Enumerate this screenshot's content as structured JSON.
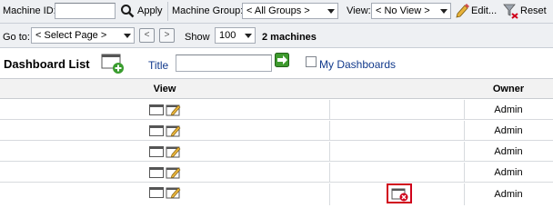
{
  "toolbar": {
    "machine_id_label": "Machine ID:",
    "machine_id_value": "",
    "apply_label": "Apply",
    "machine_group_label": "Machine Group:",
    "machine_group_value": "< All Groups >",
    "view_label": "View:",
    "view_value": "< No View >",
    "edit_label": "Edit...",
    "reset_label": "Reset"
  },
  "paging": {
    "goto_label": "Go to:",
    "goto_value": "< Select Page >",
    "prev_label": "<",
    "next_label": ">",
    "show_label": "Show",
    "show_value": "100",
    "machine_count": "2 machines"
  },
  "dashboard": {
    "title": "Dashboard List",
    "title_filter_label": "Title",
    "title_filter_value": "",
    "my_dashboards_label": "My Dashboards",
    "my_dashboards_checked": false
  },
  "table": {
    "columns": [
      "View",
      "Owner"
    ],
    "rows": [
      {
        "owner": "Admin"
      },
      {
        "owner": "Admin"
      },
      {
        "owner": "Admin"
      },
      {
        "owner": "Admin"
      },
      {
        "owner": "Admin",
        "has_delete": true
      }
    ]
  },
  "colors": {
    "toolbar_bg": "#eef0f3",
    "link_blue": "#123a8c",
    "highlight_red": "#d0021b"
  },
  "icons": [
    "search-icon",
    "edit-pencil-icon",
    "reset-filter-icon",
    "new-dashboard-icon",
    "go-arrow-icon",
    "dashboard-view-icon",
    "dashboard-edit-icon",
    "dashboard-delete-icon"
  ]
}
